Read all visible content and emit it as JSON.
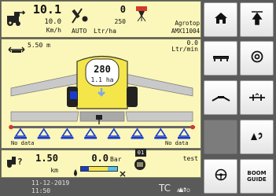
{
  "speed": {
    "value": "10.1",
    "setpoint": "10.0",
    "unit": "Km/h"
  },
  "rate": {
    "value": "0",
    "target": "250",
    "mode": "AUTO",
    "unit": "Ltr/ha"
  },
  "product": {
    "brand": "Agrotop",
    "model": "AMX11004"
  },
  "boom_width": "5.50 m",
  "flow": {
    "value": "0.0",
    "unit": "Ltr/min"
  },
  "tank": {
    "volume": "280",
    "area": "1.1 ha"
  },
  "boom_left_label": "No data",
  "boom_right_label": "No data",
  "section_count": 8,
  "bottom": {
    "distance_value": "1.50",
    "distance_unit": "km",
    "pressure_value": "0.0",
    "pressure_unit": "Bar",
    "badge": "01",
    "job_name": "test"
  },
  "status": {
    "date": "11-12-2019",
    "time": "11:50",
    "tc_label": "TC",
    "tc_sub": "AUTO"
  },
  "side_buttons": [
    {
      "icon": "home-icon"
    },
    {
      "icon": "boom-raise-icon"
    },
    {
      "icon": "boom-flat-icon"
    },
    {
      "icon": "target-rate-icon"
    },
    {
      "icon": "boom-fold-icon"
    },
    {
      "icon": "section-split-icon"
    },
    {
      "icon": "blank"
    },
    {
      "icon": "auto-section-icon"
    },
    {
      "icon": "steering-wheel-icon"
    },
    {
      "icon": "boom-guide-icon",
      "label_line1": "BOOM",
      "label_line2": "GUIDE"
    }
  ],
  "colors": {
    "panel_bg": "#fbf6ba",
    "nozzle_blue": "#1a3ccc",
    "tank_yellow": "#f4e54a",
    "section_red": "#d23a2a"
  }
}
